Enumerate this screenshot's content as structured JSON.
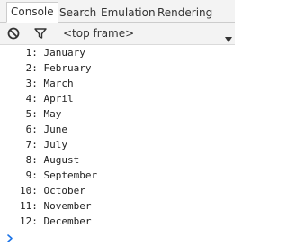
{
  "tabs": [
    {
      "label": "Console",
      "active": true
    },
    {
      "label": "Search",
      "active": false
    },
    {
      "label": "Emulation",
      "active": false
    },
    {
      "label": "Rendering",
      "active": false
    }
  ],
  "toolbar": {
    "clear_icon": "no-entry-icon",
    "filter_icon": "funnel-icon",
    "frame_label": "<top frame>",
    "dropdown_icon": "triangle-down-icon"
  },
  "console": {
    "lines": [
      " 1: January",
      " 2: February",
      " 3: March",
      " 4: April",
      " 5: May",
      " 6: June",
      " 7: July",
      " 8: August",
      " 9: September",
      "10: October",
      "11: November",
      "12: December"
    ],
    "prompt_icon": "chevron-right-icon"
  },
  "colors": {
    "accent": "#1a73e8",
    "toolbar_bg": "#f3f3f3",
    "text": "#222222"
  }
}
